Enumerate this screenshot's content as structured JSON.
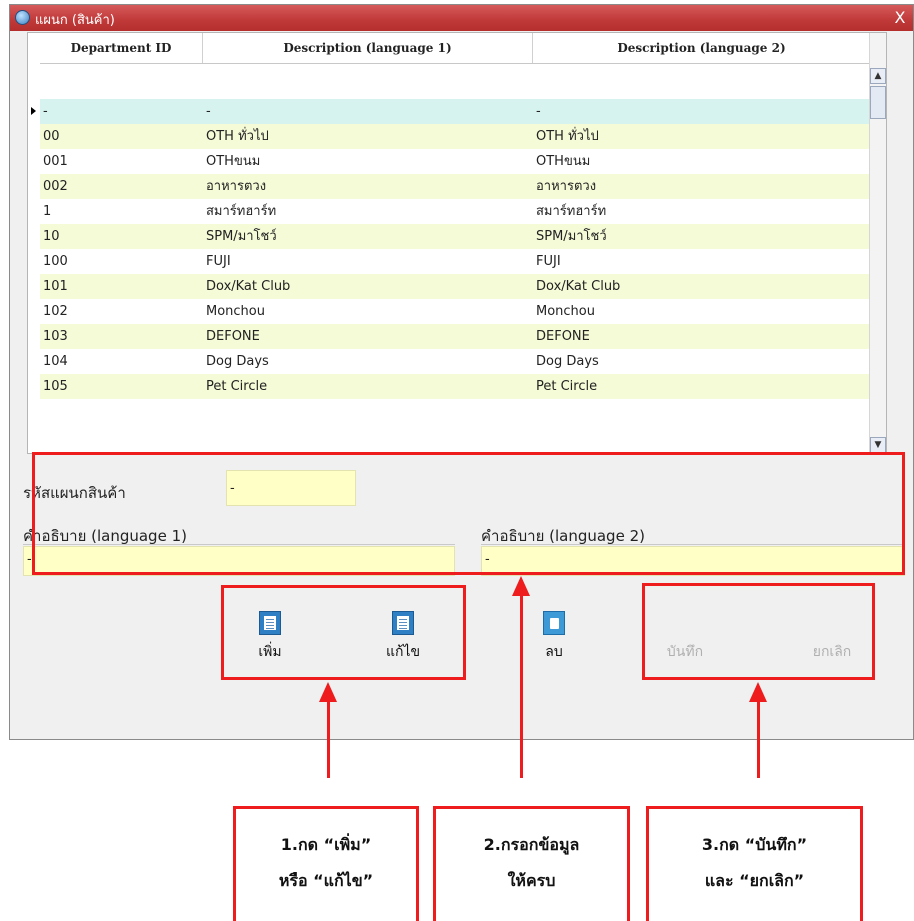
{
  "window": {
    "title": "แผนก (สินค้า)",
    "close_label": "X"
  },
  "grid": {
    "headers": [
      "Department ID",
      "Description (language 1)",
      "Description (language 2)"
    ],
    "rows": [
      {
        "id": "-",
        "desc1": "-",
        "desc2": "-"
      },
      {
        "id": "00",
        "desc1": "OTH ทั่วไป",
        "desc2": "OTH ทั่วไป"
      },
      {
        "id": "001",
        "desc1": "OTHขนม",
        "desc2": "OTHขนม"
      },
      {
        "id": "002",
        "desc1": "อาหารตวง",
        "desc2": "อาหารตวง"
      },
      {
        "id": "1",
        "desc1": "สมาร์ทฮาร์ท",
        "desc2": "สมาร์ทฮาร์ท"
      },
      {
        "id": "10",
        "desc1": "SPM/มาโชว์",
        "desc2": "SPM/มาโชว์"
      },
      {
        "id": "100",
        "desc1": "FUJI",
        "desc2": "FUJI"
      },
      {
        "id": "101",
        "desc1": "Dox/Kat Club",
        "desc2": "Dox/Kat Club"
      },
      {
        "id": "102",
        "desc1": "Monchou",
        "desc2": "Monchou"
      },
      {
        "id": "103",
        "desc1": "DEFONE",
        "desc2": "DEFONE"
      },
      {
        "id": "104",
        "desc1": "Dog Days",
        "desc2": "Dog Days"
      },
      {
        "id": "105",
        "desc1": "Pet Circle",
        "desc2": "Pet Circle"
      }
    ]
  },
  "form": {
    "dept_code_label": "รหัสแผนกสินค้า",
    "dept_code_value": "-",
    "desc1_label": "คำอธิบาย (language 1)",
    "desc1_value": "-",
    "desc2_label": "คำอธิบาย (language 2)",
    "desc2_value": "-"
  },
  "toolbar": {
    "add_label": "เพิ่ม",
    "edit_label": "แก้ไข",
    "delete_label": "ลบ",
    "save_label": "บันทึก",
    "cancel_label": "ยกเลิก"
  },
  "annotations": {
    "note1": [
      "1.กด “เพิ่ม”",
      "หรือ “แก้ไข”"
    ],
    "note2": [
      "2.กรอกข้อมูล",
      "ให้ครบ"
    ],
    "note3": [
      "3.กด “บันทึก”",
      "และ “ยกเลิก”"
    ],
    "color": "#ee1c1c"
  },
  "colors": {
    "title_bar": "#c23b3b",
    "row_alt": "#f5fbd7",
    "new_row": "#d6f3f0",
    "field_bg": "#ffffc6"
  }
}
